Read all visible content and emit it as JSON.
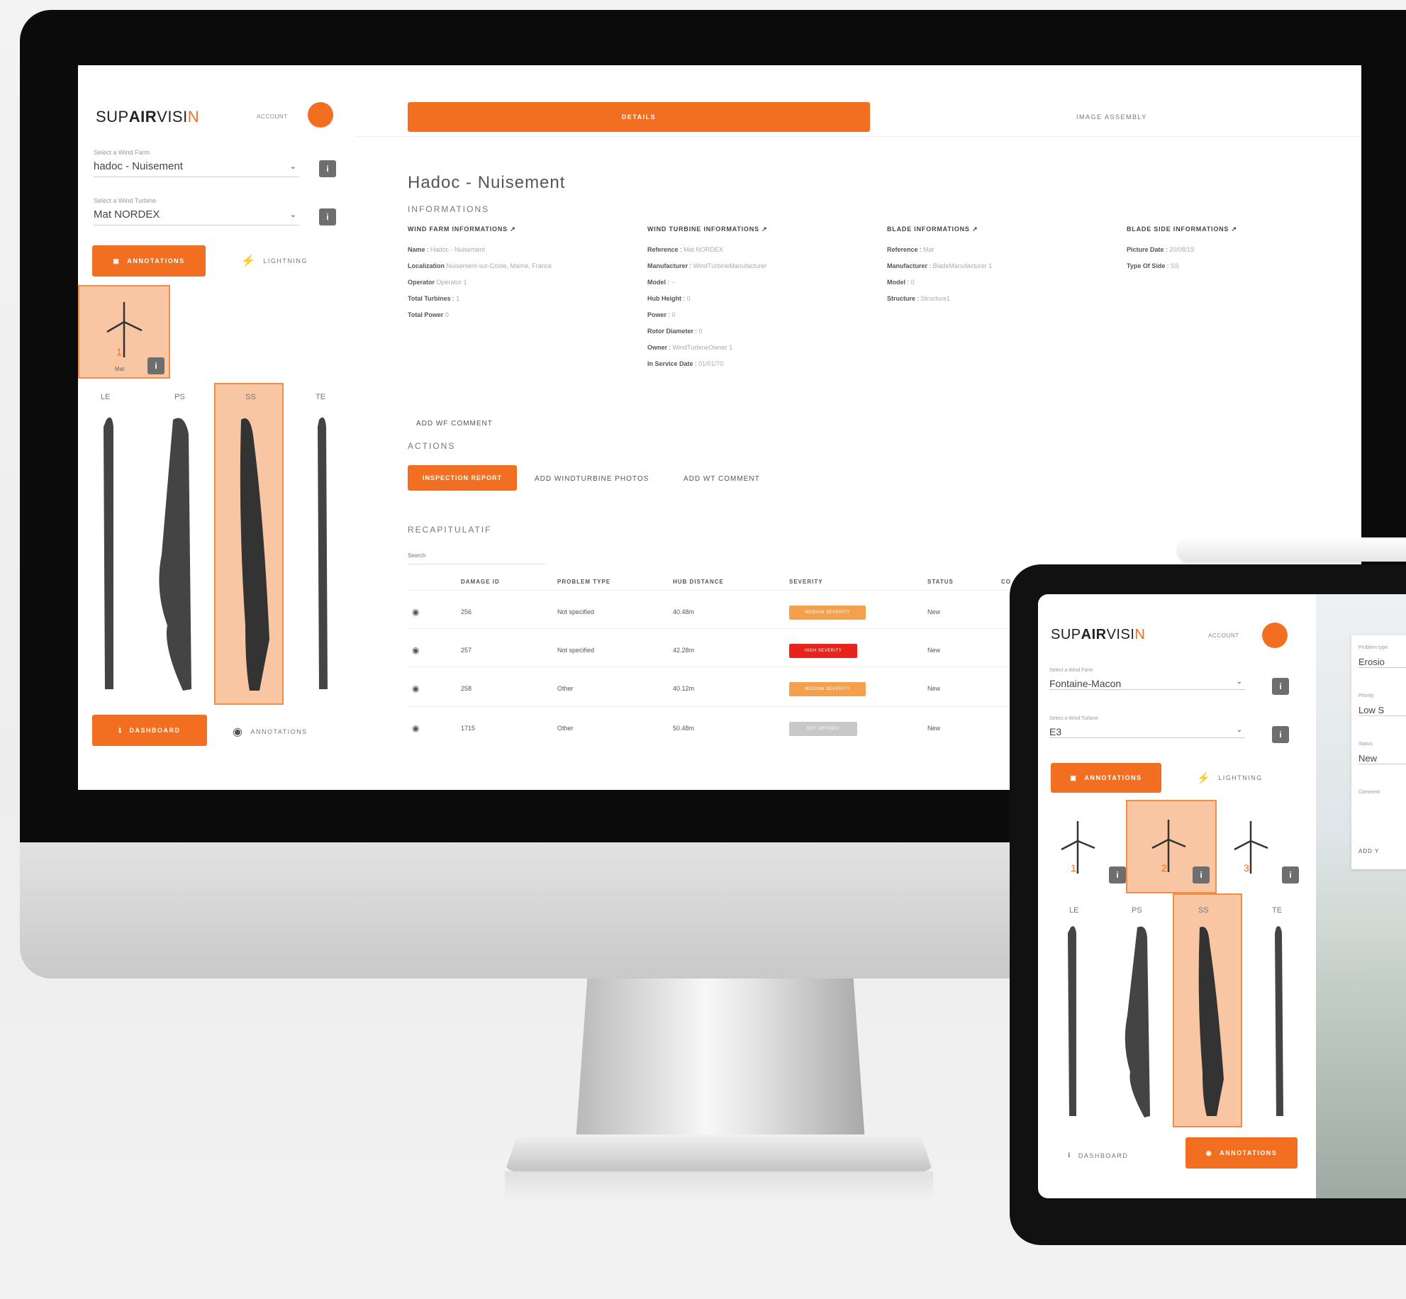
{
  "brand": {
    "logo_prefix": "SUP",
    "logo_bold": "AIR",
    "logo_suffix": "VISI",
    "logo_end": "N",
    "accent": "#f26f21"
  },
  "desktop": {
    "sidebar": {
      "account": "ACCOUNT",
      "wind_farm_label": "Select a Wind Farm",
      "wind_farm_value": "hadoc - Nuisement",
      "turbine_label": "Select a Wind Turbine",
      "turbine_value": "Mat NORDEX",
      "annotations_btn": "ANNOTATIONS",
      "lightning_btn": "LIGHTNING",
      "turbine_num": "1",
      "turbine_name": "Mat",
      "blade_labels": [
        "LE",
        "PS",
        "SS",
        "TE"
      ],
      "dashboard_btn": "DASHBOARD",
      "annotations_link": "ANNOTATIONS"
    },
    "tabs": {
      "details": "DETAILS",
      "image_assembly": "IMAGE ASSEMBLY"
    },
    "title": "Hadoc - Nuisement",
    "informations_heading": "INFORMATIONS",
    "columns": [
      {
        "heading": "WIND FARM INFORMATIONS ↗",
        "rows": [
          {
            "k": "Name",
            "v": "Hadoc - Nuisement"
          },
          {
            "k": "Localization",
            "v": "Nuisement-sur-Coole, Marne, France"
          },
          {
            "k": "Operator",
            "v": "Operator 1"
          },
          {
            "k": "Total Turbines",
            "v": "1"
          },
          {
            "k": "Total Power",
            "v": "0"
          }
        ]
      },
      {
        "heading": "WIND TURBINE INFORMATIONS ↗",
        "rows": [
          {
            "k": "Reference",
            "v": "Mat NORDEX"
          },
          {
            "k": "Manufacturer",
            "v": "WindTurbineManufacturer"
          },
          {
            "k": "Model",
            "v": "--"
          },
          {
            "k": "Hub Height",
            "v": "0"
          },
          {
            "k": "Power",
            "v": "0"
          },
          {
            "k": "Rotor Diameter",
            "v": "0"
          },
          {
            "k": "Owner",
            "v": "WindTurbineOwner 1"
          },
          {
            "k": "In Service Date",
            "v": "01/01/70"
          }
        ]
      },
      {
        "heading": "BLADE INFORMATIONS ↗",
        "rows": [
          {
            "k": "Reference",
            "v": "Mat"
          },
          {
            "k": "Manufacturer",
            "v": "BladeManufacturer 1"
          },
          {
            "k": "Model",
            "v": "0"
          },
          {
            "k": "Structure",
            "v": "Structure1"
          }
        ]
      },
      {
        "heading": "BLADE SIDE INFORMATIONS ↗",
        "rows": [
          {
            "k": "Picture Date",
            "v": "20/08/19"
          },
          {
            "k": "Type Of Side",
            "v": "SS"
          }
        ]
      }
    ],
    "add_wf_comment_top": "ADD WF COMMENT",
    "actions_heading": "ACTIONS",
    "actions": {
      "inspection": "INSPECTION REPORT",
      "photos": "ADD WINDTURBINE PHOTOS",
      "comment": "ADD WT COMMENT"
    },
    "recap_heading": "RECAPITULATIF",
    "filter_placeholder": "Search",
    "table": {
      "headers": [
        "DAMAGE ID",
        "PROBLEM TYPE",
        "HUB DISTANCE",
        "SEVERITY",
        "STATUS",
        "CO"
      ],
      "rows": [
        {
          "id": "256",
          "type": "Not specified",
          "dist": "40.48m",
          "severity": "MEDIUM SEVERITY",
          "sev_color": "#f5a04d",
          "status": "New"
        },
        {
          "id": "257",
          "type": "Not specified",
          "dist": "42.28m",
          "severity": "HIGH SEVERITY",
          "sev_color": "#e8231c",
          "status": "New"
        },
        {
          "id": "258",
          "type": "Other",
          "dist": "40.12m",
          "severity": "MEDIUM SEVERITY",
          "sev_color": "#f5a04d",
          "status": "New"
        },
        {
          "id": "1715",
          "type": "Other",
          "dist": "50.48m",
          "severity": "NOT DEFINED",
          "sev_color": "#c8c8c8",
          "status": "New"
        }
      ]
    }
  },
  "tablet": {
    "account": "ACCOUNT",
    "wind_farm_label": "Select a Wind Farm",
    "wind_farm_value": "Fontaine-Macon",
    "turbine_label": "Select a Wind Turbine",
    "turbine_value": "E3",
    "annotations_btn": "ANNOTATIONS",
    "lightning_btn": "LIGHTNING",
    "turbines": [
      "1",
      "2",
      "3"
    ],
    "blade_labels": [
      "LE",
      "PS",
      "SS",
      "TE"
    ],
    "dashboard_btn": "DASHBOARD",
    "annotations_bottom": "ANNOTATIONS",
    "form": {
      "problem_label": "Problem type",
      "problem_value": "Erosio",
      "priority_label": "Priority",
      "priority_value": "Low S",
      "status_label": "Status",
      "status_value": "New",
      "comment_label": "Comment",
      "add_btn": "ADD Y"
    }
  }
}
